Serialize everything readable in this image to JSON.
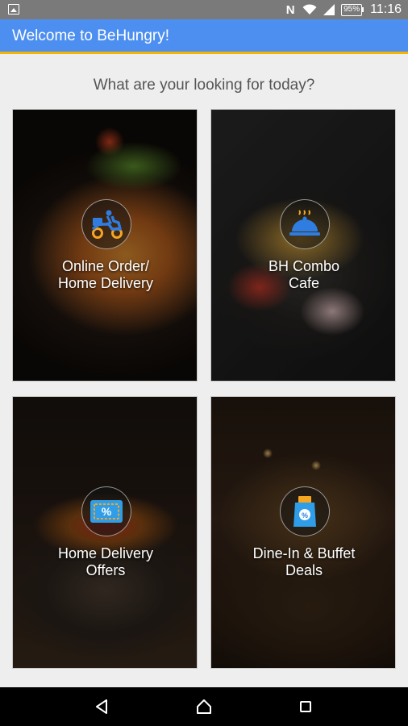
{
  "status_bar": {
    "time": "11:16",
    "battery_percent": "95%",
    "icons": [
      "image-notification-icon",
      "nfc-icon",
      "wifi-icon",
      "signal-icon",
      "battery-icon"
    ]
  },
  "app_bar": {
    "title": "Welcome to BeHungry!",
    "colors": {
      "background": "#4d8ff0",
      "accent": "#f5b400"
    }
  },
  "main": {
    "subtitle": "What are your looking for today?",
    "tiles": [
      {
        "line1": "Online Order/",
        "line2": "Home Delivery",
        "icon": "scooter-delivery-icon"
      },
      {
        "line1": "BH Combo",
        "line2": "Cafe",
        "icon": "cloche-icon"
      },
      {
        "line1": "Home Delivery",
        "line2": "Offers",
        "icon": "coupon-icon"
      },
      {
        "line1": "Dine-In & Buffet",
        "line2": "Deals",
        "icon": "discount-bag-icon"
      }
    ]
  },
  "nav_bar": {
    "icons": [
      "back-icon",
      "home-icon",
      "recent-apps-icon"
    ]
  }
}
